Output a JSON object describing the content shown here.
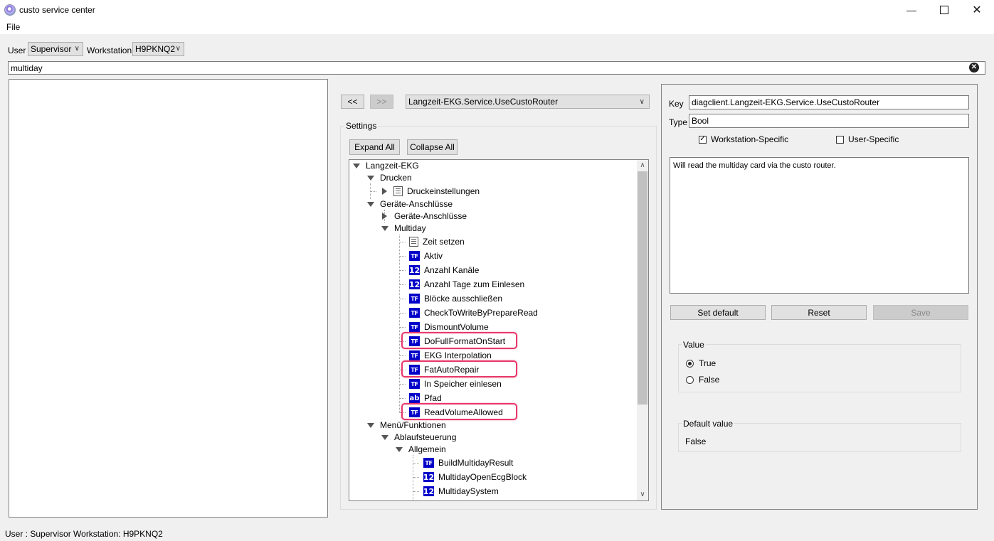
{
  "window": {
    "title": "custo service center",
    "minimize_icon": "minimize-icon",
    "maximize_icon": "maximize-icon",
    "close_icon": "close-icon"
  },
  "menu": {
    "file": "File"
  },
  "toolbar": {
    "user_label": "User",
    "user_value": "Supervisor",
    "workstation_label": "Workstation",
    "workstation_value": "H9PKNQ2"
  },
  "search": {
    "value": "multiday"
  },
  "nav": {
    "back": "<<",
    "forward": ">>",
    "selected_path": "Langzeit-EKG.Service.UseCustoRouter"
  },
  "settings": {
    "group_label": "Settings",
    "expand_all": "Expand All",
    "collapse_all": "Collapse All",
    "tree": [
      {
        "label": "Langzeit-EKG",
        "level": 0,
        "toggle": "expanded",
        "icon": ""
      },
      {
        "label": "Drucken",
        "level": 1,
        "toggle": "expanded",
        "icon": ""
      },
      {
        "label": "Druckeinstellungen",
        "level": 2,
        "toggle": "collapsed",
        "icon": "doc"
      },
      {
        "label": "Geräte-Anschlüsse",
        "level": 1,
        "toggle": "expanded",
        "icon": ""
      },
      {
        "label": "Geräte-Anschlüsse",
        "level": 2,
        "toggle": "collapsed",
        "icon": ""
      },
      {
        "label": "Multiday",
        "level": 2,
        "toggle": "expanded",
        "icon": ""
      },
      {
        "label": "Zeit setzen",
        "level": 3,
        "toggle": "",
        "icon": "doc"
      },
      {
        "label": "Aktiv",
        "level": 3,
        "toggle": "",
        "icon": "TF"
      },
      {
        "label": "Anzahl Kanäle",
        "level": 3,
        "toggle": "",
        "icon": "12"
      },
      {
        "label": "Anzahl Tage zum Einlesen",
        "level": 3,
        "toggle": "",
        "icon": "12"
      },
      {
        "label": "Blöcke ausschließen",
        "level": 3,
        "toggle": "",
        "icon": "TF"
      },
      {
        "label": "CheckToWriteByPrepareRead",
        "level": 3,
        "toggle": "",
        "icon": "TF"
      },
      {
        "label": "DismountVolume",
        "level": 3,
        "toggle": "",
        "icon": "TF"
      },
      {
        "label": "DoFullFormatOnStart",
        "level": 3,
        "toggle": "",
        "icon": "TF",
        "highlighted": true
      },
      {
        "label": "EKG Interpolation",
        "level": 3,
        "toggle": "",
        "icon": "TF"
      },
      {
        "label": "FatAutoRepair",
        "level": 3,
        "toggle": "",
        "icon": "TF",
        "highlighted": true
      },
      {
        "label": "In Speicher einlesen",
        "level": 3,
        "toggle": "",
        "icon": "TF"
      },
      {
        "label": "Pfad",
        "level": 3,
        "toggle": "",
        "icon": "ab"
      },
      {
        "label": "ReadVolumeAllowed",
        "level": 3,
        "toggle": "",
        "icon": "TF",
        "highlighted": true
      },
      {
        "label": "Menü/Funktionen",
        "level": 1,
        "toggle": "expanded",
        "icon": ""
      },
      {
        "label": "Ablaufsteuerung",
        "level": 2,
        "toggle": "expanded",
        "icon": ""
      },
      {
        "label": "Allgemein",
        "level": 3,
        "toggle": "expanded",
        "icon": ""
      },
      {
        "label": "BuildMultidayResult",
        "level": 4,
        "toggle": "",
        "icon": "TF"
      },
      {
        "label": "MultidayOpenEcgBlock",
        "level": 4,
        "toggle": "",
        "icon": "12"
      },
      {
        "label": "MultidaySystem",
        "level": 4,
        "toggle": "",
        "icon": "12"
      }
    ]
  },
  "details": {
    "key_label": "Key",
    "key_value": "diagclient.Langzeit-EKG.Service.UseCustoRouter",
    "type_label": "Type",
    "type_value": "Bool",
    "workstation_specific_label": "Workstation-Specific",
    "workstation_specific_checked": true,
    "user_specific_label": "User-Specific",
    "user_specific_checked": false,
    "description": "Will read the multiday card via the custo router.",
    "set_default": "Set default",
    "reset": "Reset",
    "save": "Save",
    "value_group": "Value",
    "option_true": "True",
    "option_false": "False",
    "selected": "True",
    "default_group": "Default value",
    "default_value": "False"
  },
  "statusbar": {
    "text": "User : Supervisor  Workstation: H9PKNQ2"
  },
  "colors": {
    "highlight": "#e8386b",
    "icon_blue": "#0000c8"
  }
}
